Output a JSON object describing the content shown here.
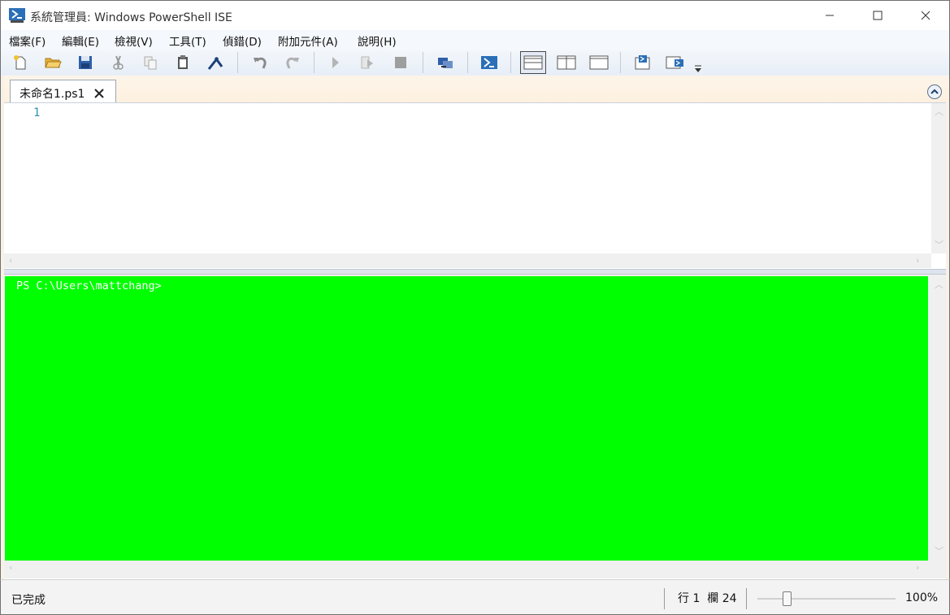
{
  "window": {
    "title": "系統管理員: Windows PowerShell ISE",
    "app_icon": "powershell-ise-icon",
    "controls": [
      "minimize-icon",
      "maximize-icon",
      "close-icon"
    ]
  },
  "menu": {
    "items": [
      {
        "label": "檔案(F)"
      },
      {
        "label": "編輯(E)"
      },
      {
        "label": "檢視(V)"
      },
      {
        "label": "工具(T)"
      },
      {
        "label": "偵錯(D)"
      },
      {
        "label": "附加元件(A)"
      },
      {
        "label": "說明(H)"
      }
    ]
  },
  "toolbar": {
    "buttons": [
      "new-script-icon",
      "open-folder-icon",
      "save-icon",
      "cut-icon",
      "copy-icon",
      "paste-icon",
      "clear-console-icon",
      "undo-icon",
      "redo-icon",
      "run-script-icon",
      "run-selection-icon",
      "stop-icon",
      "remote-powershell-icon",
      "powershell-console-icon",
      "show-script-top-icon",
      "show-script-right-icon",
      "show-script-maximized-icon",
      "show-script-pane-icon",
      "show-command-addon-icon"
    ],
    "selected_layout": "show-script-top-icon"
  },
  "tabs": [
    {
      "label": "未命名1.ps1",
      "active": true
    }
  ],
  "editor": {
    "line_numbers": [
      "1"
    ]
  },
  "console": {
    "prompt": "PS C:\\Users\\mattchang>",
    "background_color": "#00ff00",
    "text_color": "#ffffff"
  },
  "status": {
    "text": "已完成",
    "position": "行 1  欄 24",
    "zoom": "100%",
    "zoom_level_fraction": 0.2
  }
}
